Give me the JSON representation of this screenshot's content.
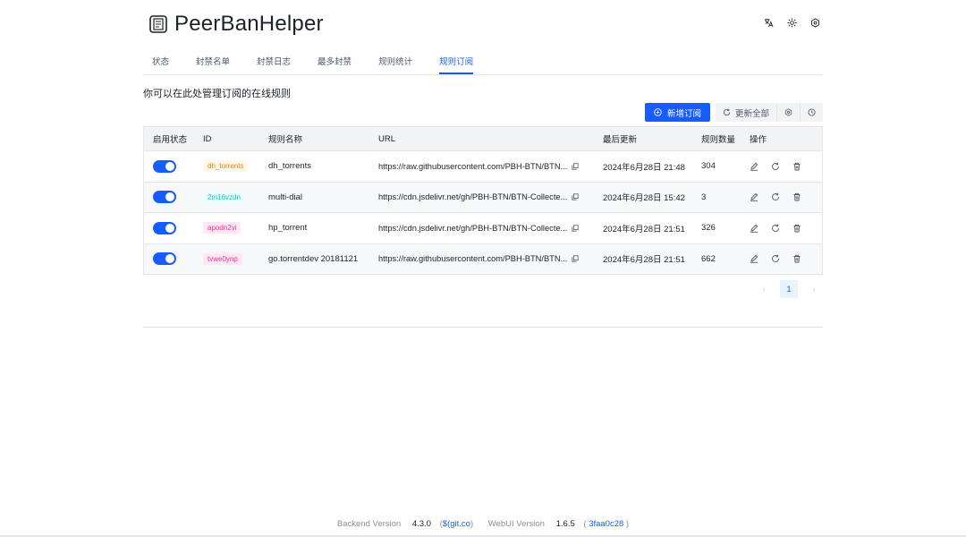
{
  "app": {
    "title": "PeerBanHelper"
  },
  "tabs": [
    "状态",
    "封禁名单",
    "封禁日志",
    "最多封禁",
    "规则统计",
    "规则订阅"
  ],
  "active_tab": "规则订阅",
  "description": "你可以在此处管理订阅的在线规则",
  "toolbar": {
    "add_label": "新增订阅",
    "update_all_label": "更新全部"
  },
  "table": {
    "headers": [
      "启用状态",
      "ID",
      "规则名称",
      "URL",
      "最后更新",
      "规则数量",
      "操作"
    ],
    "rows": [
      {
        "enabled": true,
        "id": "dh_torrents",
        "id_color": "#ff7d00",
        "id_bg": "#fff7e8",
        "name": "dh_torrents",
        "url": "https://raw.githubusercontent.com/PBH-BTN/BTN...",
        "updated": "2024年6月28日 21:48",
        "count": "304"
      },
      {
        "enabled": true,
        "id": "2m16vzdn",
        "id_color": "#0fc6c2",
        "id_bg": "#e8fffb",
        "name": "multi-dial",
        "url": "https://cdn.jsdelivr.net/gh/PBH-BTN/BTN-Collecte...",
        "updated": "2024年6月28日 15:42",
        "count": "3"
      },
      {
        "enabled": true,
        "id": "apodn2vi",
        "id_color": "#f5319d",
        "id_bg": "#ffe8f1",
        "name": "hp_torrent",
        "url": "https://cdn.jsdelivr.net/gh/PBH-BTN/BTN-Collecte...",
        "updated": "2024年6月28日 21:51",
        "count": "326"
      },
      {
        "enabled": true,
        "id": "tvwe0ynp",
        "id_color": "#f5319d",
        "id_bg": "#ffe8f1",
        "name": "go.torrentdev 20181121",
        "url": "https://raw.githubusercontent.com/PBH-BTN/BTN...",
        "updated": "2024年6月28日 21:51",
        "count": "662"
      }
    ]
  },
  "pagination": {
    "current": "1"
  },
  "footer": {
    "backend_label": "Backend Version",
    "backend_version": "4.3.0",
    "backend_link": "$(git.co",
    "webui_label": "WebUI Version",
    "webui_version": "1.6.5",
    "webui_link": "3faa0c28"
  },
  "colors": {
    "accent": "#165dff"
  }
}
